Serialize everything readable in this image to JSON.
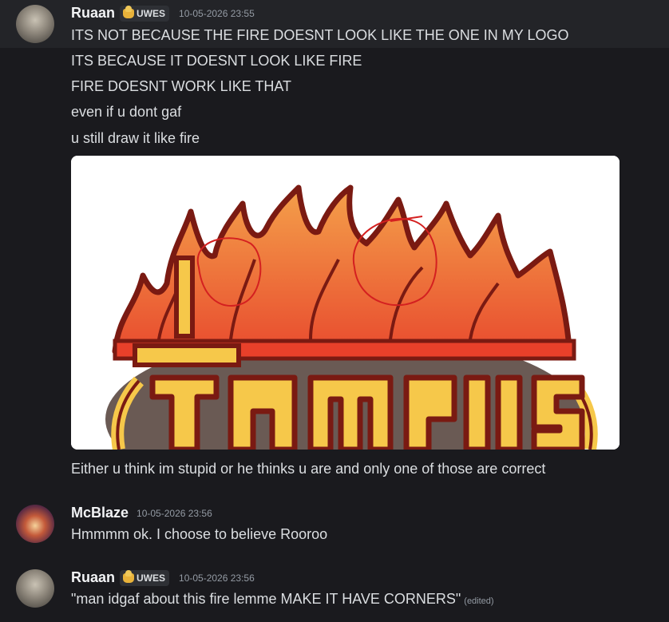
{
  "messages": [
    {
      "author": "Ruaan",
      "tag": "UWES",
      "timestamp": "10-05-2026 23:55",
      "lines": [
        "ITS NOT BECAUSE THE FIRE DOESNT LOOK LIKE THE ONE IN MY LOGO",
        "ITS BECAUSE IT DOESNT LOOK LIKE FIRE",
        "FIRE DOESNT WORK LIKE THAT",
        "even if u dont gaf",
        "u still draw it like fire"
      ],
      "after_attachment": "Either u think im stupid or he thinks u are and only one of those are correct"
    },
    {
      "author": "McBlaze",
      "timestamp": "10-05-2026 23:56",
      "lines": [
        "Hmmmm ok. I choose to believe Rooroo"
      ]
    },
    {
      "author": "Ruaan",
      "tag": "UWES",
      "timestamp": "10-05-2026 23:56",
      "lines": [
        "\"man idgaf about this fire lemme MAKE IT HAVE CORNERS\""
      ],
      "edited": "(edited)"
    }
  ],
  "attachment": {
    "logo_text": "CAMPUS",
    "colors": {
      "flame_top": "#f4a04a",
      "flame_bottom": "#e84a2e",
      "outline": "#7a1a12",
      "letters": "#f6c84a",
      "annotation": "#d42020"
    }
  }
}
